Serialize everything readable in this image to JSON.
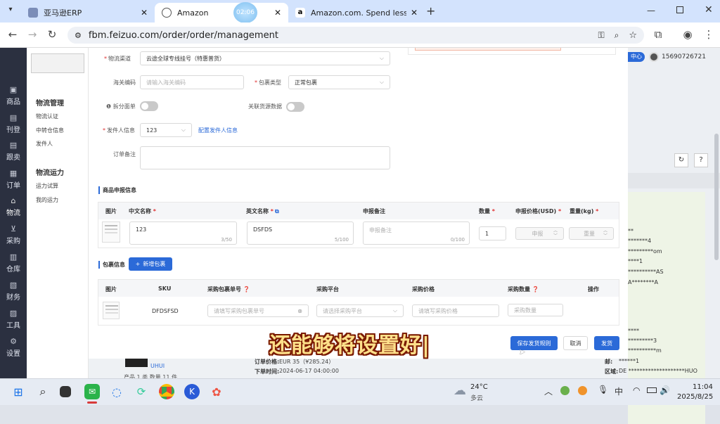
{
  "browser": {
    "tabs": [
      {
        "label": "亚马逊ERP",
        "active": false
      },
      {
        "label": "Amazon",
        "active": true
      },
      {
        "label": "Amazon.com. Spend less. Sm",
        "active": false
      }
    ],
    "timer_badge": "02:06",
    "url": "fbm.feizuo.com/order/order/management"
  },
  "sidebar": {
    "items": [
      {
        "label": "商品",
        "icon": "box-icon"
      },
      {
        "label": "刊登",
        "icon": "publish-icon"
      },
      {
        "label": "跟卖",
        "icon": "follow-icon"
      },
      {
        "label": "订单",
        "icon": "order-icon"
      },
      {
        "label": "物流",
        "icon": "home-icon",
        "active": true
      },
      {
        "label": "采购",
        "icon": "cart-icon"
      },
      {
        "label": "仓库",
        "icon": "warehouse-icon"
      },
      {
        "label": "财务",
        "icon": "finance-icon"
      },
      {
        "label": "工具",
        "icon": "tool-icon"
      },
      {
        "label": "设置",
        "icon": "gear-icon"
      }
    ]
  },
  "submenu": {
    "group1_title": "物流管理",
    "group1_items": [
      "物流认证",
      "中转仓信息",
      "发件人"
    ],
    "group2_title": "物流运力",
    "group2_items": [
      "运力试算",
      "我的运力"
    ]
  },
  "topright": {
    "center_label": "中心",
    "phone": "15690726721"
  },
  "form": {
    "logistics_channel_label": "物流渠道",
    "logistics_channel_value": "云途全球专线挂号（特惠普货）",
    "customs_code_label": "海关编码",
    "customs_code_placeholder": "请输入海关编码",
    "package_type_label": "包裹类型",
    "package_type_value": "正常包裹",
    "split_label": "拆分面单",
    "link_purchase_label": "关联货源数据",
    "sender_label": "发件人信息",
    "sender_value": "123",
    "sender_link": "配置发件人信息",
    "remark_label": "订单备注"
  },
  "declare": {
    "title": "商品申报信息",
    "headers": [
      "图片",
      "中文名称",
      "英文名称",
      "申报备注",
      "数量",
      "申报价格(USD)",
      "重量(kg)"
    ],
    "cn_name": "123",
    "cn_counter": "3/50",
    "en_name": "DSFDS",
    "en_counter": "5/100",
    "remark_placeholder": "申报备注",
    "remark_counter": "0/100",
    "qty": "1",
    "price_placeholder": "申报",
    "weight_placeholder": "重量"
  },
  "package": {
    "title": "包裹信息",
    "add_button": "新增包裹",
    "headers": [
      "图片",
      "SKU",
      "采购包裹单号",
      "采购平台",
      "采购价格",
      "采购数量",
      "操作"
    ],
    "sku": "DFDSFSD",
    "tracking_placeholder": "请填写采购包裹单号",
    "platform_placeholder": "请选择采购平台",
    "price_placeholder": "请填写采购价格",
    "qty_placeholder": "采购数量"
  },
  "footer": {
    "save_rule": "保存发货规则",
    "cancel": "取消",
    "ship": "发货"
  },
  "background": {
    "order_price_label": "订单价格:",
    "order_price_value": "EUR 35（¥285.24）",
    "order_time_label": "下单时间:",
    "order_time_value": "2024-06-17 04:00:00",
    "user_tag": "UHUI",
    "bottom_left": "产品 1 类  数量 11 件",
    "region_label": "区域:",
    "region_value": "DE ********************HUO",
    "address_label": "邮:",
    "address_value": "******1",
    "right_lines": [
      "**",
      "*******4",
      "*********om",
      "****1",
      "**********AS",
      "A********A",
      "****",
      "*********3",
      "**********m"
    ]
  },
  "subtitle": "还能够将设置好|",
  "taskbar": {
    "weather_temp": "24°C",
    "weather_desc": "多云",
    "ime": "中",
    "time": "11:04",
    "date": "2025/8/25"
  },
  "colors": {
    "accent": "#2b6ad8",
    "sidebar": "#2b3040",
    "subtitle_fill": "#ffe08a",
    "subtitle_stroke": "#7a1a00"
  }
}
